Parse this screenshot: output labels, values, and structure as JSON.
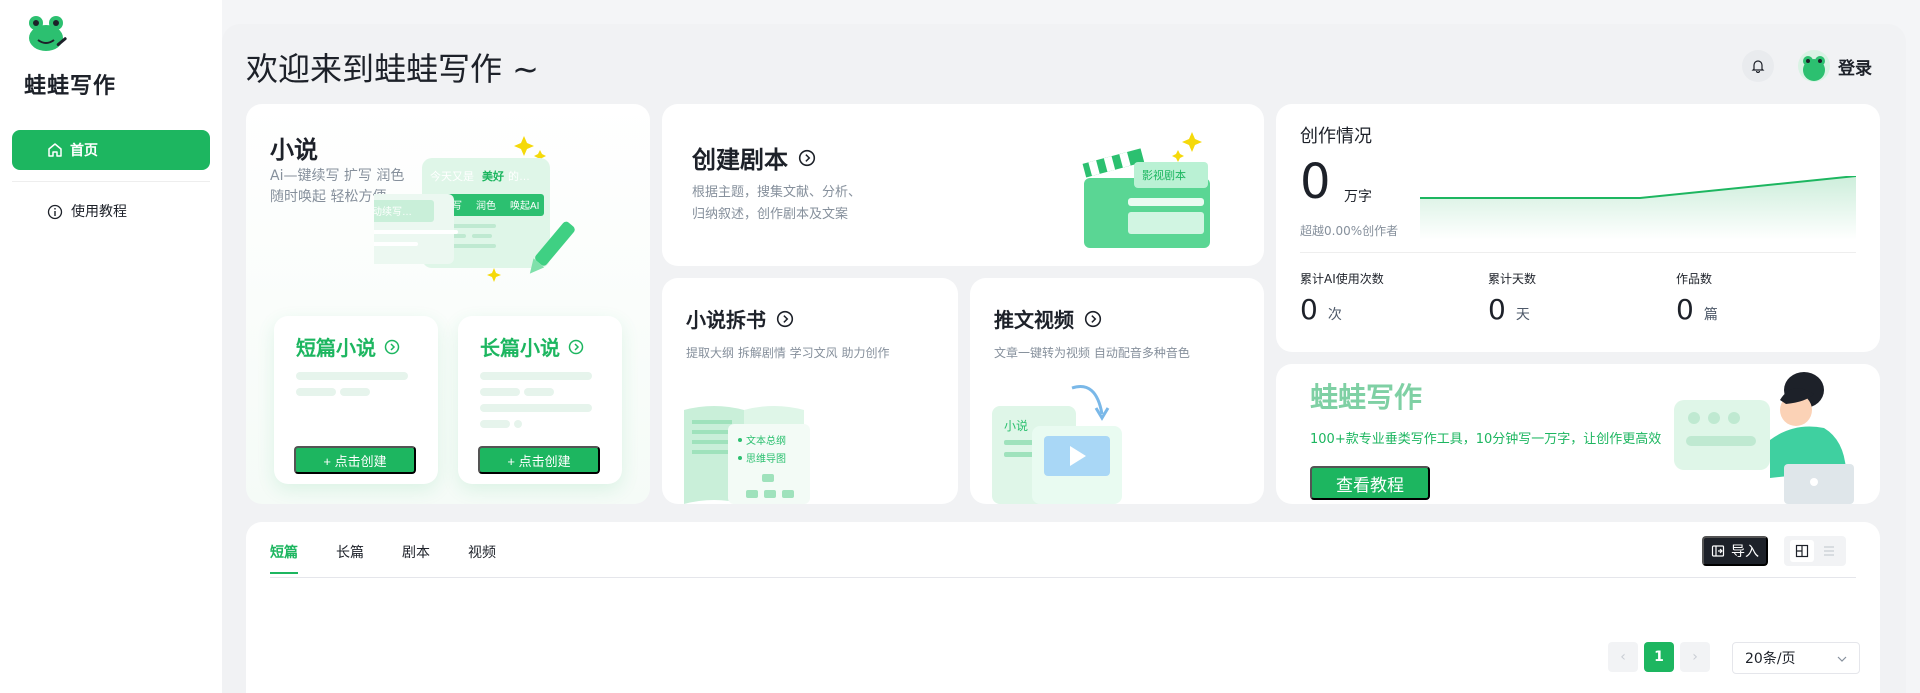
{
  "brand": {
    "name": "蛙蛙写作"
  },
  "nav": {
    "home": "首页",
    "tutorial": "使用教程"
  },
  "header": {
    "welcome": "欢迎来到蛙蛙写作 ~",
    "login": "登录"
  },
  "novel_card": {
    "title": "小说",
    "desc_line1": "Ai—键续写 扩写 润色",
    "desc_line2": "随时唤起 轻松方便",
    "illus": {
      "bubble_text1": "今天又是",
      "bubble_text2": "美好",
      "bubble_text3": "的…",
      "chip1": "扩写",
      "chip2": "润色",
      "chip3": "唤起AI",
      "autowrite": "自动续写…"
    },
    "short": {
      "title": "短篇小说",
      "button": "+ 点击创建"
    },
    "long": {
      "title": "长篇小说",
      "button": "+ 点击创建"
    }
  },
  "script_card": {
    "title": "创建剧本",
    "desc_line1": "根据主题，搜集文献、分析、",
    "desc_line2": "归纳叙述，创作剧本及文案",
    "illus_label": "影视剧本"
  },
  "split_card": {
    "title": "小说拆书",
    "desc": "提取大纲 拆解剧情 学习文风 助力创作",
    "illus": {
      "item1": "文本总纲",
      "item2": "思维导图"
    }
  },
  "video_card": {
    "title": "推文视频",
    "desc": "文章一键转为视频 自动配音多种音色",
    "illus_label": "小说"
  },
  "stats": {
    "title": "创作情况",
    "big_value": "0",
    "big_unit": "万字",
    "sub": "超越0.00%创作者",
    "metrics": [
      {
        "label": "累计AI使用次数",
        "value": "0",
        "unit": "次"
      },
      {
        "label": "累计天数",
        "value": "0",
        "unit": "天"
      },
      {
        "label": "作品数",
        "value": "0",
        "unit": "篇"
      }
    ],
    "colors": {
      "line": "#1db660",
      "fill": "#e3f6ea"
    }
  },
  "promo": {
    "title": "蛙蛙写作",
    "desc": "100+款专业垂类写作工具，10分钟写一万字，让创作更高效",
    "button": "查看教程"
  },
  "works": {
    "tabs": [
      "短篇",
      "长篇",
      "剧本",
      "视频"
    ],
    "active_tab": "短篇",
    "import_label": "导入",
    "pager": {
      "current": "1",
      "prev": "‹",
      "next": "›"
    },
    "page_size": "20条/页"
  },
  "colors": {
    "accent": "#1db660",
    "dark_button": "#1d2129"
  }
}
